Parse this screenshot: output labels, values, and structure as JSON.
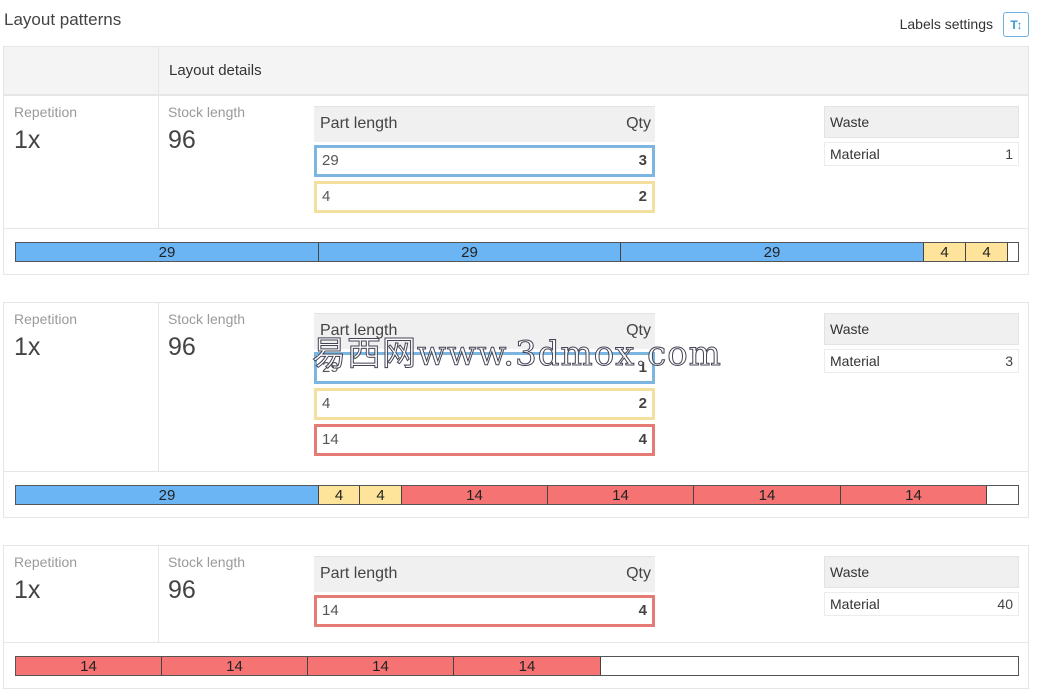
{
  "page": {
    "title": "Layout patterns"
  },
  "toolbar": {
    "labels_settings_label": "Labels settings",
    "labels_settings_icon": "T↕"
  },
  "table_header": {
    "layout_details": "Layout details"
  },
  "colors": {
    "blue": "#6cb5f5",
    "yellow": "#fde49a",
    "red": "#f57373",
    "blue_border": "#7cb6e0",
    "yellow_border": "#f5df9e",
    "red_border": "#e57b75"
  },
  "labels": {
    "repetition": "Repetition",
    "stock_length": "Stock length",
    "part_length": "Part length",
    "qty": "Qty",
    "waste": "Waste",
    "material": "Material"
  },
  "patterns": [
    {
      "repetition": "1x",
      "stock_length": "96",
      "parts": [
        {
          "length": "29",
          "qty": "3",
          "color": "blue"
        },
        {
          "length": "4",
          "qty": "2",
          "color": "yellow"
        }
      ],
      "waste_material": "1",
      "bar": [
        {
          "label": "29",
          "length": 29,
          "color": "blue"
        },
        {
          "label": "29",
          "length": 29,
          "color": "blue"
        },
        {
          "label": "29",
          "length": 29,
          "color": "blue"
        },
        {
          "label": "4",
          "length": 4,
          "color": "yellow"
        },
        {
          "label": "4",
          "length": 4,
          "color": "yellow"
        }
      ]
    },
    {
      "repetition": "1x",
      "stock_length": "96",
      "parts": [
        {
          "length": "29",
          "qty": "1",
          "color": "blue"
        },
        {
          "length": "4",
          "qty": "2",
          "color": "yellow"
        },
        {
          "length": "14",
          "qty": "4",
          "color": "red"
        }
      ],
      "waste_material": "3",
      "bar": [
        {
          "label": "29",
          "length": 29,
          "color": "blue"
        },
        {
          "label": "4",
          "length": 4,
          "color": "yellow"
        },
        {
          "label": "4",
          "length": 4,
          "color": "yellow"
        },
        {
          "label": "14",
          "length": 14,
          "color": "red"
        },
        {
          "label": "14",
          "length": 14,
          "color": "red"
        },
        {
          "label": "14",
          "length": 14,
          "color": "red"
        },
        {
          "label": "14",
          "length": 14,
          "color": "red"
        }
      ]
    },
    {
      "repetition": "1x",
      "stock_length": "96",
      "parts": [
        {
          "length": "14",
          "qty": "4",
          "color": "red"
        }
      ],
      "waste_material": "40",
      "bar": [
        {
          "label": "14",
          "length": 14,
          "color": "red"
        },
        {
          "label": "14",
          "length": 14,
          "color": "red"
        },
        {
          "label": "14",
          "length": 14,
          "color": "red"
        },
        {
          "label": "14",
          "length": 14,
          "color": "red"
        }
      ]
    }
  ],
  "watermark": "易西网www.3dmox.com"
}
